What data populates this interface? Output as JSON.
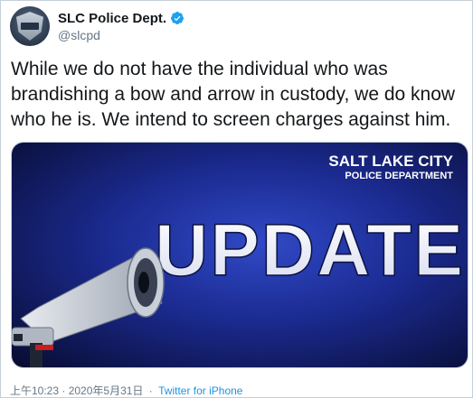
{
  "tweet": {
    "author": {
      "display_name": "SLC Police Dept.",
      "handle": "@slcpd",
      "verified": true
    },
    "text": "While we do not have the individual who was brandishing a bow and arrow in custody, we do know who he is. We intend to screen charges against him.",
    "media": {
      "headline": "UPDATE",
      "brand_line1": "SALT LAKE CITY",
      "brand_line2": "POLICE DEPARTMENT",
      "icon": "megaphone-icon"
    },
    "timestamp": "上午10:23 · 2020年5月31日",
    "separator": "·",
    "source": "Twitter for iPhone"
  },
  "colors": {
    "text_primary": "#14171a",
    "text_secondary": "#657786",
    "link": "#1b95e0",
    "verified": "#1da1f2",
    "media_bg": "#1a2a8a"
  }
}
